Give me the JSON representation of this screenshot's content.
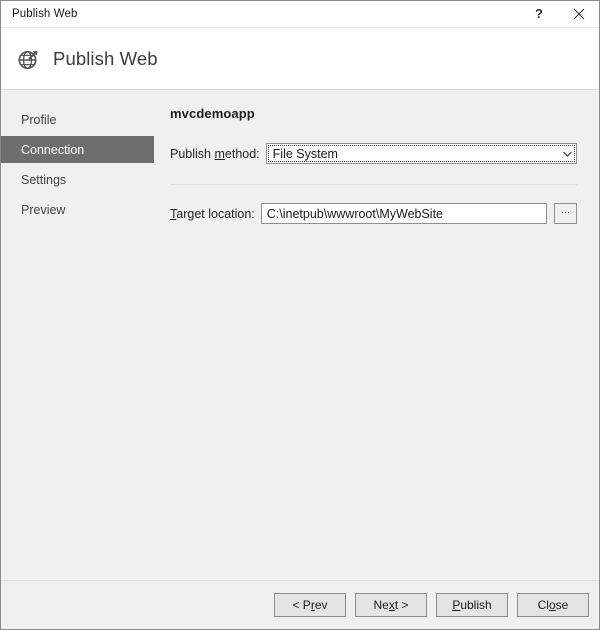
{
  "window": {
    "title": "Publish Web",
    "help_icon": "question-mark-icon",
    "help_label": "?",
    "close_icon": "close-icon"
  },
  "header": {
    "icon": "globe-publish-icon",
    "title": "Publish Web"
  },
  "sidebar": {
    "items": [
      {
        "label": "Profile",
        "selected": false
      },
      {
        "label": "Connection",
        "selected": true
      },
      {
        "label": "Settings",
        "selected": false
      },
      {
        "label": "Preview",
        "selected": false
      }
    ]
  },
  "main": {
    "app_name": "mvcdemoapp",
    "publish_method": {
      "label_before": "Publish ",
      "label_accel": "m",
      "label_after": "ethod:",
      "value": "File System",
      "arrow_icon": "chevron-down-icon",
      "options": [
        "File System"
      ]
    },
    "target_location": {
      "label_accel": "T",
      "label_after": "arget location:",
      "value": "C:\\inetpub\\wwwroot\\MyWebSite",
      "placeholder": "",
      "browse_label": "..."
    }
  },
  "footer": {
    "buttons": [
      {
        "name": "prev-button",
        "before": "< P",
        "accel": "r",
        "after": "ev"
      },
      {
        "name": "next-button",
        "before": "Ne",
        "accel": "x",
        "after": "t >"
      },
      {
        "name": "publish-button",
        "before": "",
        "accel": "P",
        "after": "ublish"
      },
      {
        "name": "close-button",
        "before": "Cl",
        "accel": "o",
        "after": "se"
      }
    ]
  },
  "colors": {
    "dialog_background": "#f0f0f0",
    "header_background": "#ffffff",
    "selected_nav": "#6e6e6e",
    "text": "#242424",
    "border": "#8f8f8f"
  }
}
